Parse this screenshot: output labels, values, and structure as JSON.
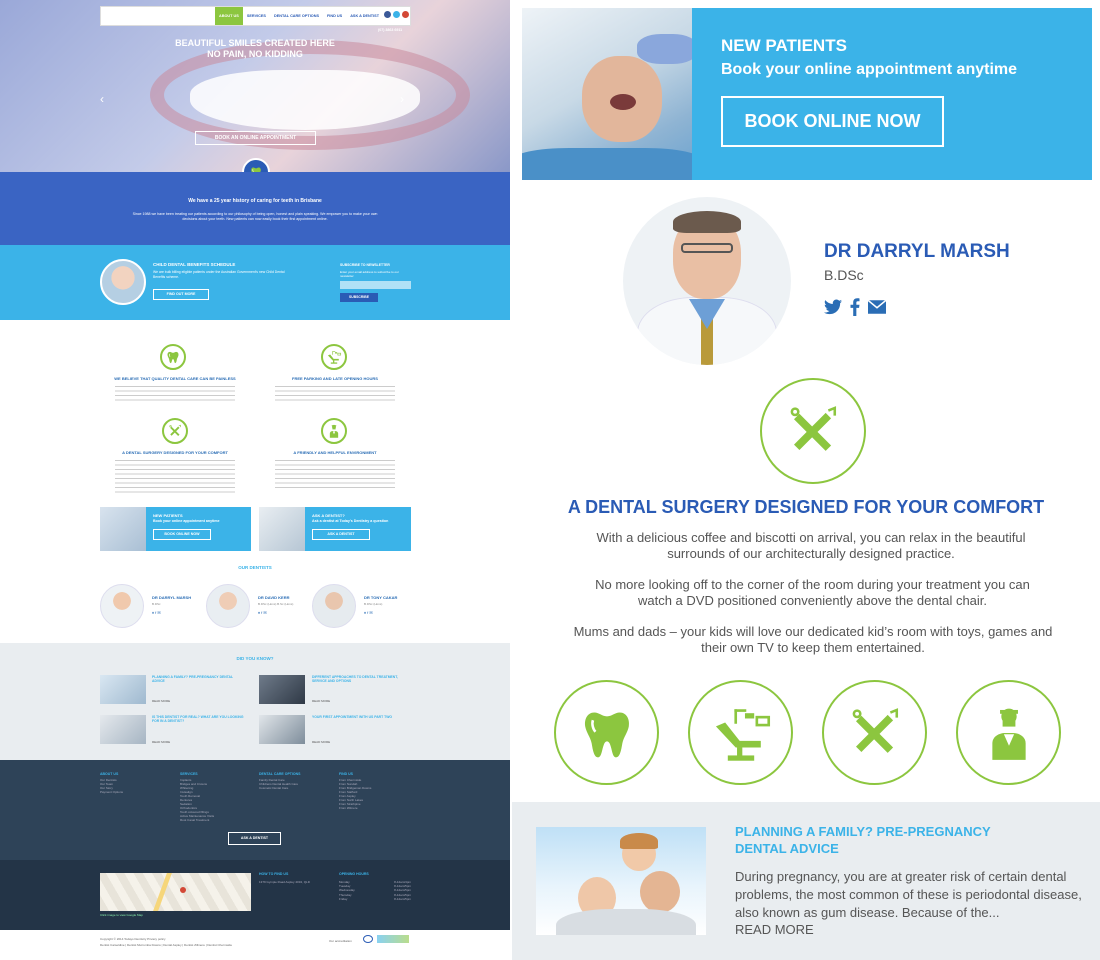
{
  "left": {
    "nav": {
      "items": [
        "ABOUT US",
        "SERVICES",
        "DENTAL CARE OPTIONS",
        "FIND US",
        "ASK A DENTIST"
      ],
      "phone": "(07) 3863 6911"
    },
    "hero": {
      "line1": "BEAUTIFUL SMILES CREATED HERE",
      "line2": "NO PAIN, NO KIDDING",
      "button": "BOOK AN ONLINE APPOINTMENT"
    },
    "history": {
      "title": "We have a 25 year history of caring for teeth in Brisbane",
      "body": "Since 1988 we have been treating our patients according to our philosophy of being open, honest and plain speaking. We empower you to make your own decisions about your teeth. New patients can now easily book their first appointment online."
    },
    "benefits": {
      "title": "CHILD DENTAL BENEFITS SCHEDULE",
      "body": "We are bulk billing eligible patients under the Australian Government's new Child Dental Benefits scheme.",
      "button": "FIND OUT MORE",
      "newsletter_title": "SUBSCRIBE TO NEWSLETTER",
      "newsletter_text": "Enter your email address to subscribe to our newsletter",
      "subscribe": "SUBSCRIBE"
    },
    "features": [
      {
        "title": "WE BELIEVE THAT QUALITY DENTAL CARE CAN BE PAINLESS",
        "icon": "tooth-icon"
      },
      {
        "title": "FREE PARKING AND LATE OPENING HOURS",
        "icon": "dental-chair-icon"
      },
      {
        "title": "A DENTAL SURGERY DESIGNED FOR YOUR COMFORT",
        "icon": "dental-tools-icon"
      },
      {
        "title": "A FRIENDLY AND HELPFUL ENVIRONMENT",
        "icon": "dentist-icon"
      }
    ],
    "promos": [
      {
        "title": "NEW PATIENTS",
        "sub": "Book your online appointment anytime",
        "button": "BOOK ONLINE NOW"
      },
      {
        "title": "ASK A DENTIST?",
        "sub": "Ask a dentist at Today's Dentistry a question",
        "button": "ASK A DENTIST"
      }
    ],
    "our_dentists": "OUR DENTISTS",
    "dentists": [
      {
        "name": "DR DARRYL MARSH",
        "deg": "B.DSc"
      },
      {
        "name": "DR DAVID KERR",
        "deg": "B.DSc (Hons) B.Sc (Hons)"
      },
      {
        "name": "DR TONY CAKAR",
        "deg": "B.DSc (Hons)"
      }
    ],
    "did_you_know": "DID YOU KNOW?",
    "articles": [
      {
        "title": "PLANNING A FAMILY? PRE-PREGNANCY DENTAL ADVICE",
        "more": "READ MORE"
      },
      {
        "title": "DIFFERENT APPROACHES TO DENTAL TREATMENT, SERVICE AND OPTIONS",
        "more": "READ MORE"
      },
      {
        "title": "IS THIS DENTIST FOR REAL? WHAT ARE YOU LOOKING FOR IN A DENTIST?",
        "more": "READ MORE"
      },
      {
        "title": "YOUR FIRST APPOINTMENT WITH US PART TWO",
        "more": "READ MORE"
      }
    ],
    "footer_cols": [
      {
        "head": "ABOUT US",
        "items": [
          "Our Dentists",
          "Our Team",
          "Our Story",
          "Payment Options"
        ]
      },
      {
        "head": "SERVICES",
        "items": [
          "Implants",
          "Bridges and Crowns",
          "Whitening",
          "Invisalign",
          "Tooth Removal",
          "Dentures",
          "Sedation",
          "Orthodontics",
          "Tooth coloured fillings",
          "Active Maintenance Visits",
          "Root Canal Treatment"
        ]
      },
      {
        "head": "DENTAL CARE OPTIONS",
        "items": [
          "Family Dental Care",
          "Childrens Dental Health Care",
          "Cosmetic Dental Care"
        ]
      },
      {
        "head": "FIND US",
        "items": [
          "From Chermside",
          "From Nundah",
          "From Bridgeman Downs",
          "From Stafford",
          "From Aspley",
          "From North Lakes",
          "From Strathpine",
          "From Zillmere"
        ]
      }
    ],
    "footer_button": "ASK A DENTIST",
    "how_to_find": "HOW TO FIND US",
    "address": "1379 Gympie Road Aspley 4034, QLD",
    "opening_hours": "OPENING HOURS",
    "hours": [
      {
        "day": "Monday",
        "time": "8-12am/4pm"
      },
      {
        "day": "Tuesday",
        "time": "8-12am/5pm"
      },
      {
        "day": "Wednesday",
        "time": "8-12am/5pm"
      },
      {
        "day": "Thursday",
        "time": "8-12am/5pm"
      },
      {
        "day": "Friday",
        "time": "8-12am/5pm"
      }
    ],
    "map_caption": "Click image to view Google Map",
    "copyright": "Copyright © 2014 Todays Dentistry   Privacy policy",
    "bottom_links": "Dentist Carseldine | Dentist Murrumba Downs | Dental Aspley | Dentist Zillmere | Dentist Chermside",
    "accreditation": "Our accreditation"
  },
  "right": {
    "promo": {
      "title": "NEW PATIENTS",
      "sub": "Book your online appointment anytime",
      "button": "BOOK ONLINE NOW"
    },
    "dentist": {
      "name": "DR DARRYL MARSH",
      "deg": "B.DSc"
    },
    "feature": {
      "title": "A DENTAL SURGERY DESIGNED FOR YOUR COMFORT",
      "p1": "With a delicious coffee and biscotti on arrival, you can relax in the beautiful surrounds of our architecturally designed practice.",
      "p2": "No more looking off to the corner of the room during your treatment you can watch a DVD positioned conveniently above the dental chair.",
      "p3": "Mums and dads – your kids will love our dedicated kid’s room with toys, games and their own TV to keep them entertained."
    },
    "icons": [
      "tooth-icon",
      "dental-chair-icon",
      "dental-tools-icon",
      "dentist-icon"
    ],
    "article": {
      "title": "PLANNING A FAMILY? PRE-PREGNANCY DENTAL ADVICE",
      "body": "During pregnancy, you are at greater risk of certain dental problems, the most common of these is periodontal disease, also known as gum disease. Because of the...",
      "more": "READ MORE"
    }
  },
  "colors": {
    "blue": "#3bb3e8",
    "navy": "#2a5bb5",
    "green": "#8cc63f",
    "footer": "#2e4358"
  }
}
